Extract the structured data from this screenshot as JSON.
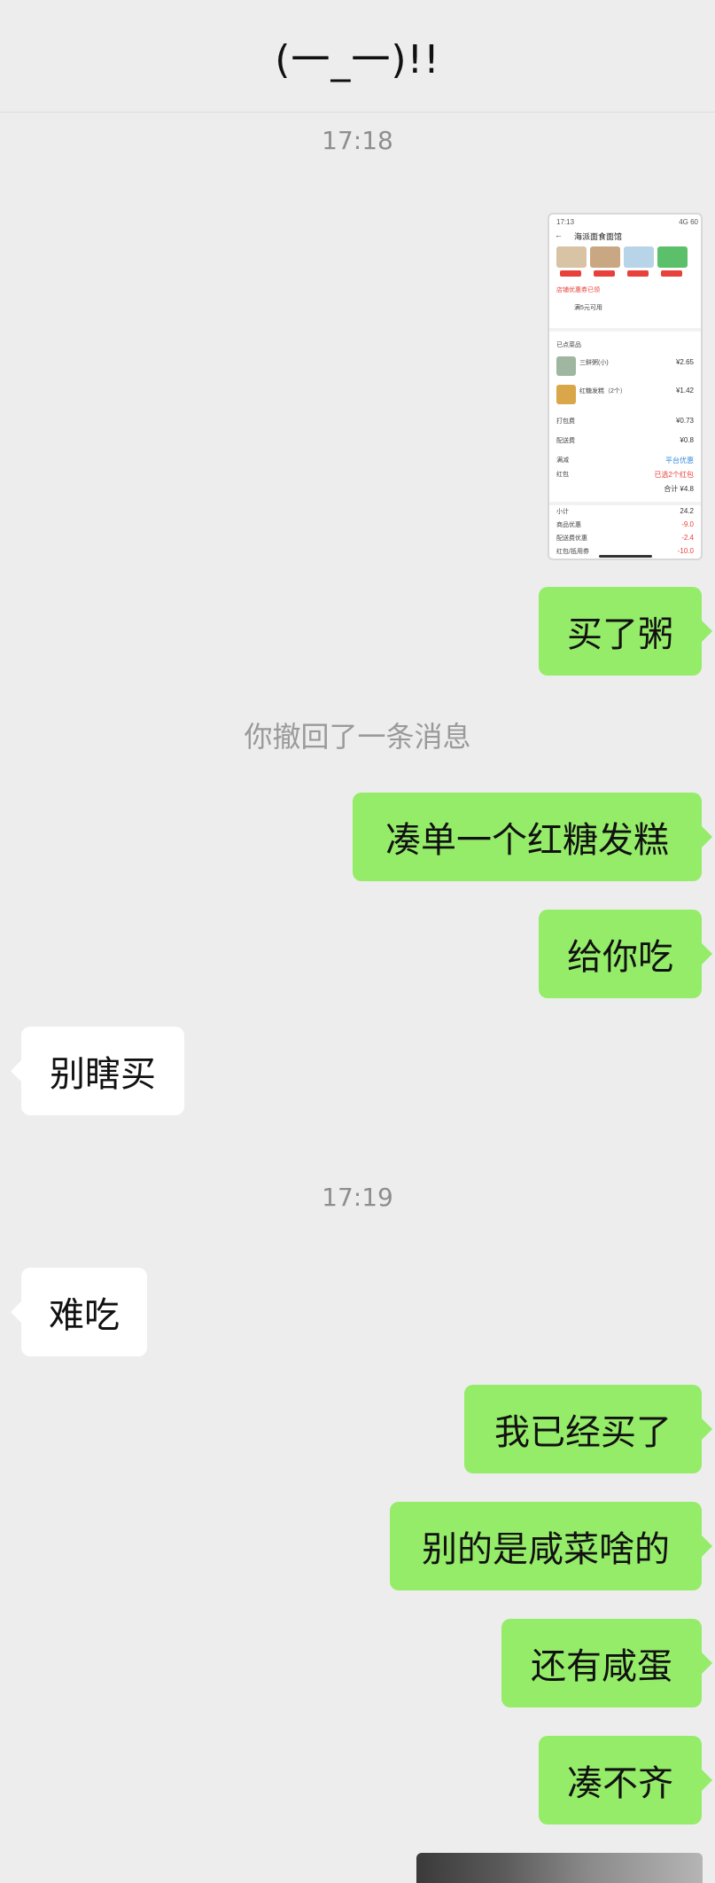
{
  "header": {
    "title": "(一_一)!!"
  },
  "timestamps": {
    "t1": "17:18",
    "t2": "17:19"
  },
  "system": {
    "recalled": "你撤回了一条消息"
  },
  "messages": {
    "m1": "买了粥",
    "m2": "凑单一个红糖发糕",
    "m3": "给你吃",
    "m4": "别瞎买",
    "m5": "难吃",
    "m6": "我已经买了",
    "m7": "别的是咸菜啥的",
    "m8": "还有咸蛋",
    "m9": "凑不齐"
  },
  "screenshot": {
    "status_time": "17:13",
    "status_right": "4G 60",
    "back": "←",
    "shop_name": "海派面食面馆",
    "coupon_line": "店铺优惠券已领",
    "coupon_detail": "满5元可用",
    "section_title": "已点菜品",
    "item1_name": "三鲜粥(小)",
    "item1_price": "¥2.65",
    "item2_name": "红糖发糕（2个）",
    "item2_price": "¥1.42",
    "pack_label": "打包费",
    "pack_price": "¥0.73",
    "delivery_label": "配送费",
    "delivery_price": "¥0.8",
    "discount_label": "满减",
    "discount_value": "平台优惠",
    "red_label": "红包",
    "red_value": "已选2个红包",
    "total_line": "合计 ¥4.8",
    "sum1_label": "小计",
    "sum1_value": "24.2",
    "sum2_label": "商品优惠",
    "sum2_value": "-9.0",
    "sum3_label": "配送费优惠",
    "sum3_value": "-2.4",
    "sum4_label": "红包/抵用券",
    "sum4_value": "-10.0"
  }
}
